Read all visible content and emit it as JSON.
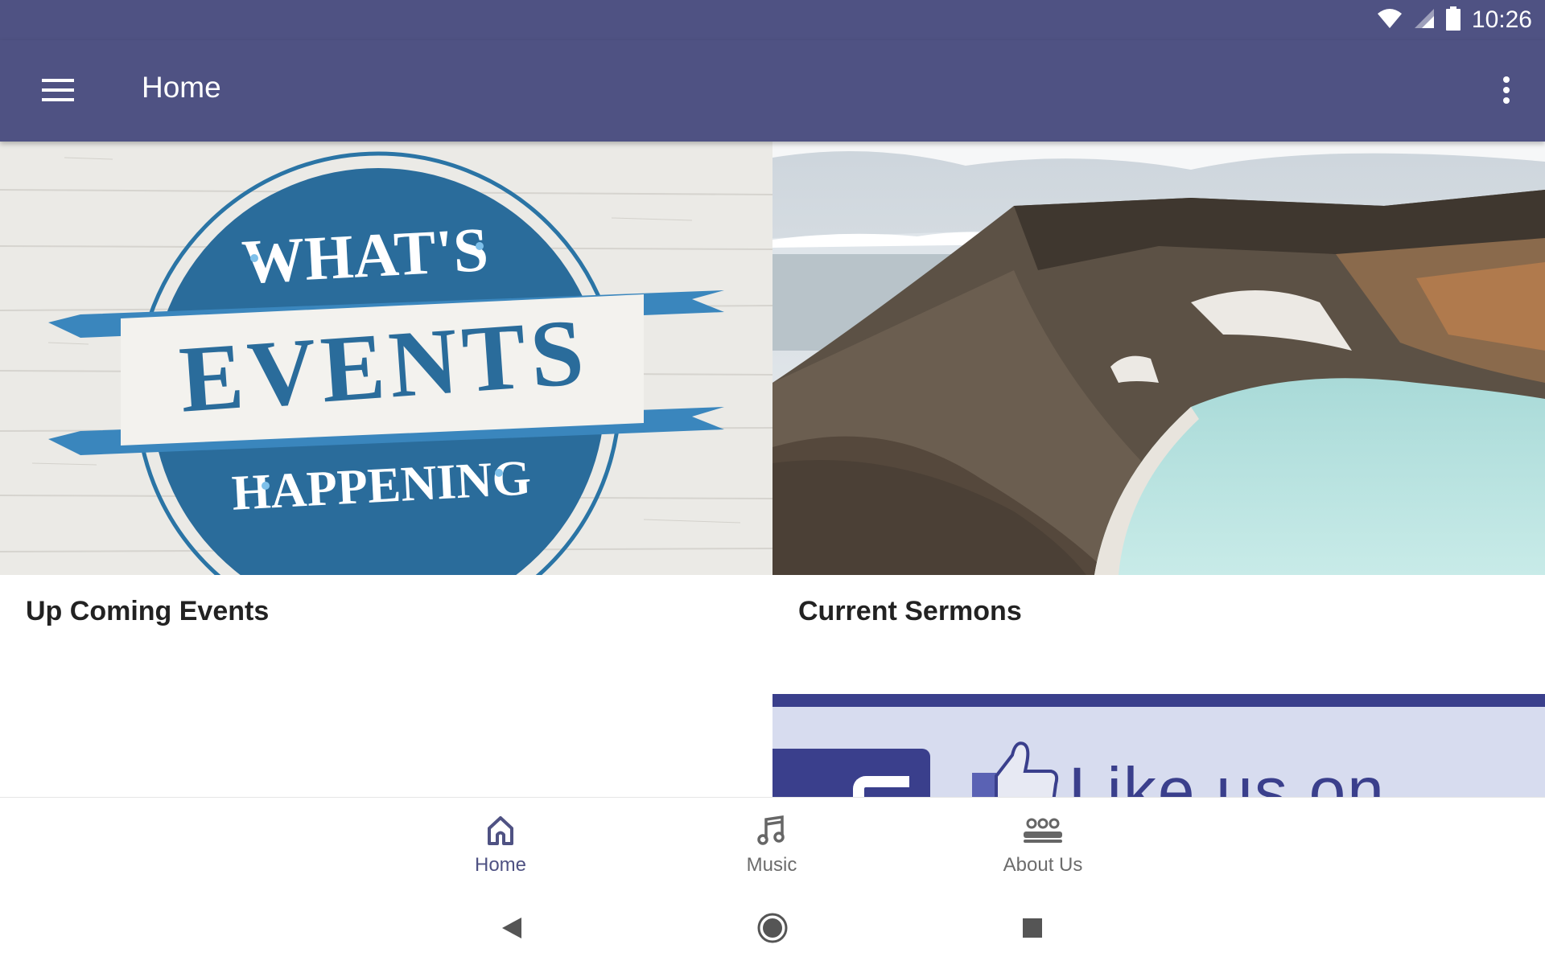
{
  "status_bar": {
    "time": "10:26",
    "icons": [
      "wifi-icon",
      "cellular-signal-icon",
      "battery-icon"
    ]
  },
  "app_bar": {
    "title": "Home",
    "menu_icon": "hamburger-menu-icon",
    "overflow_icon": "more-vert-icon",
    "background_color": "#4f5283"
  },
  "cards": [
    {
      "title": "Up Coming Events",
      "image_text": {
        "top": "WHAT'S",
        "middle": "EVENTS",
        "bottom": "HAPPENING"
      }
    },
    {
      "title": "Current Sermons"
    }
  ],
  "facebook_banner": {
    "text": "Like us on"
  },
  "bottom_nav": {
    "items": [
      {
        "label": "Home",
        "icon": "home-icon",
        "active": true
      },
      {
        "label": "Music",
        "icon": "music-note-icon",
        "active": false
      },
      {
        "label": "About Us",
        "icon": "group-icon",
        "active": false
      }
    ],
    "active_color": "#4f5283",
    "inactive_color": "#6c6c6c"
  },
  "system_nav": {
    "buttons": [
      "back-icon",
      "home-circle-icon",
      "recents-icon"
    ]
  }
}
